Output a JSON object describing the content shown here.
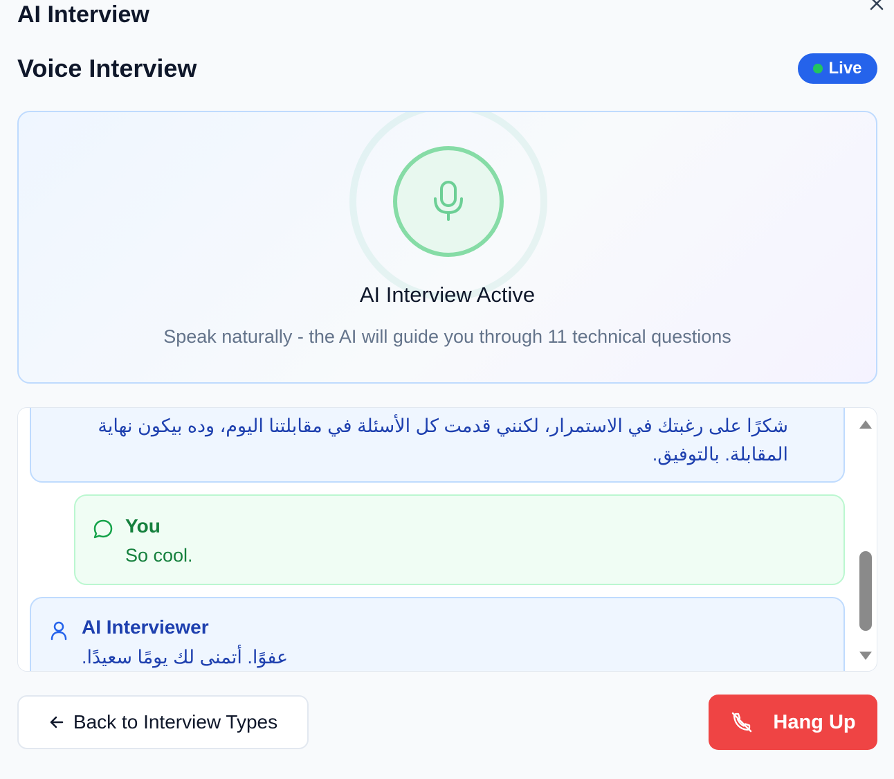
{
  "dialog": {
    "title": "AI Interview",
    "close_icon": "close-icon"
  },
  "header": {
    "title": "Voice Interview",
    "status_badge": "Live",
    "status_dot_color": "#22c55e",
    "badge_color": "#2563eb"
  },
  "status_card": {
    "icon": "microphone-icon",
    "title": "AI Interview Active",
    "subtitle": "Speak naturally - the AI will guide you through 11 technical questions"
  },
  "transcript": {
    "messages": [
      {
        "role": "ai",
        "text": "شكرًا على رغبتك في الاستمرار، لكنني قدمت كل الأسئلة في مقابلتنا اليوم، وده بيكون نهاية المقابلة. بالتوفيق."
      },
      {
        "role": "user",
        "author": "You",
        "icon": "chat-bubble-icon",
        "text": "So cool."
      },
      {
        "role": "ai",
        "author": "AI Interviewer",
        "icon": "user-icon",
        "text": "عفوًا. أتمنى لك يومًا سعيدًا."
      }
    ]
  },
  "footer": {
    "back_label": "Back to Interview Types",
    "back_icon": "arrow-left-icon",
    "hangup_label": "Hang Up",
    "hangup_icon": "phone-off-icon",
    "hangup_color": "#ef4444"
  }
}
